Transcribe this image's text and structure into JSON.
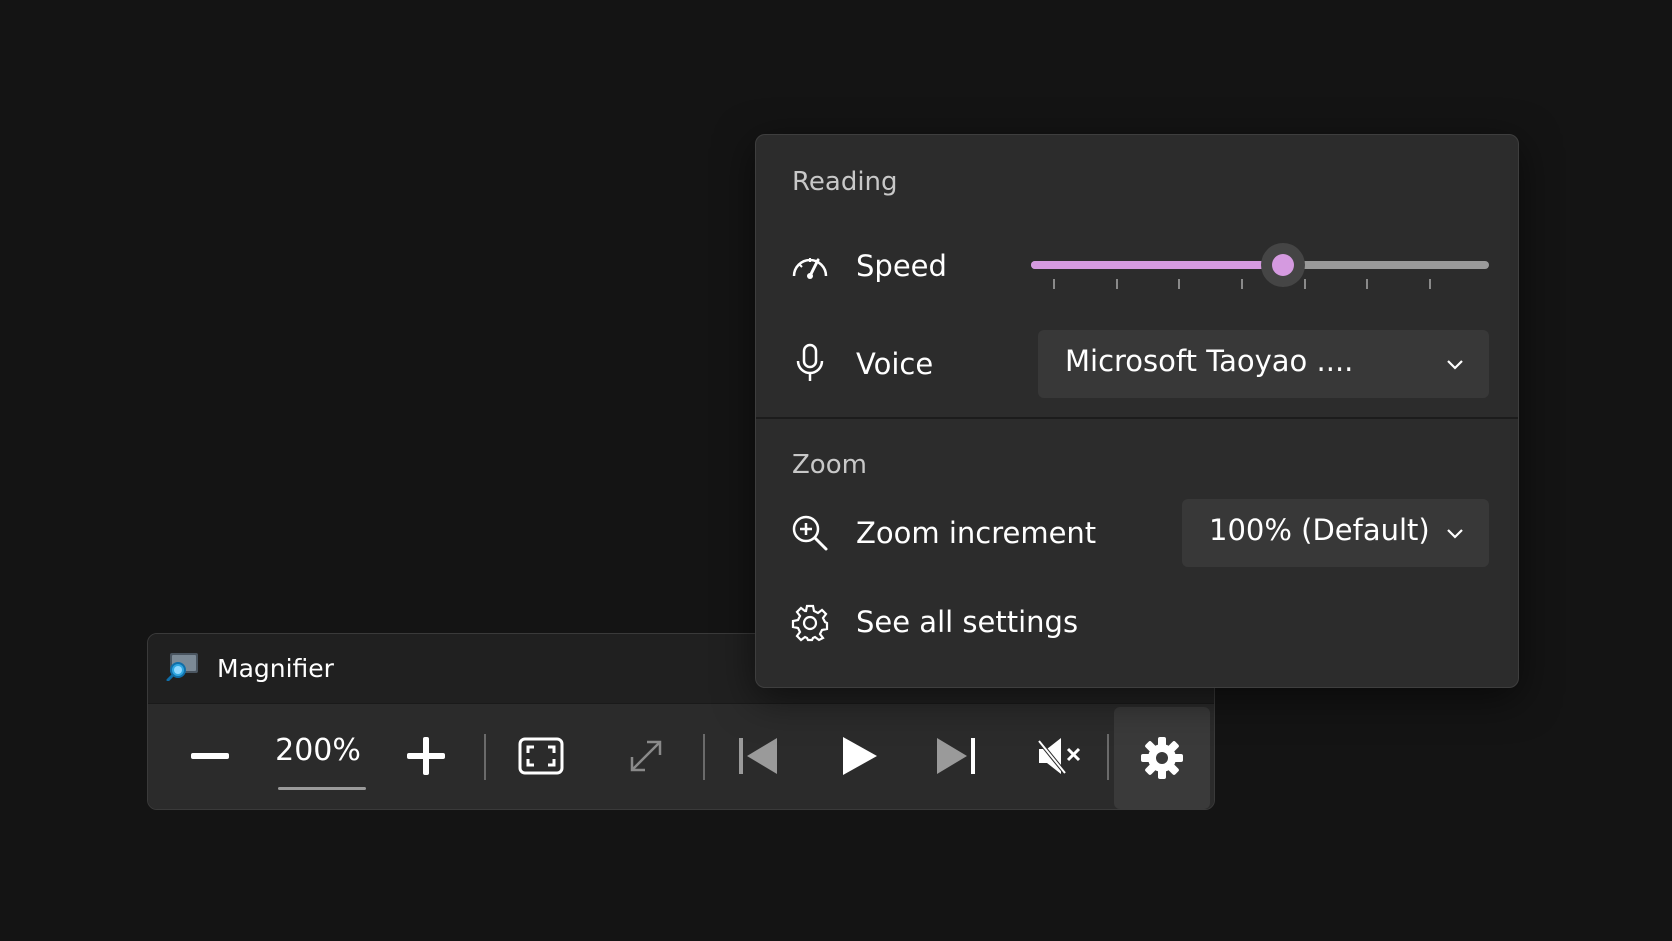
{
  "colors": {
    "background": "#141414",
    "accent": "#d59ae0",
    "panel": "#2c2c2c",
    "toolbar": "#2b2b2b"
  },
  "magnifier": {
    "title": "Magnifier",
    "zoom_level": "200%",
    "icons": {
      "app": "magnifier-app-icon",
      "zoom_out": "minus-icon",
      "zoom_in": "plus-icon",
      "view": "full-screen-view-icon",
      "resize": "resize-arrows-icon",
      "previous": "skip-previous-icon",
      "play": "play-icon",
      "next": "skip-next-icon",
      "mute": "speaker-muted-icon",
      "settings": "gear-icon"
    }
  },
  "flyout": {
    "reading": {
      "section_label": "Reading",
      "speed": {
        "label": "Speed",
        "icon": "speedometer-icon",
        "value_fraction": 0.55,
        "tick_count": 7
      },
      "voice": {
        "label": "Voice",
        "icon": "microphone-icon",
        "selected": "Microsoft Taoyao ...."
      }
    },
    "zoom": {
      "section_label": "Zoom",
      "zoom_increment": {
        "label": "Zoom increment",
        "icon": "zoom-in-magnifier-icon",
        "selected": "100% (Default)"
      },
      "see_all_settings": {
        "label": "See all settings",
        "icon": "gear-icon"
      }
    }
  }
}
